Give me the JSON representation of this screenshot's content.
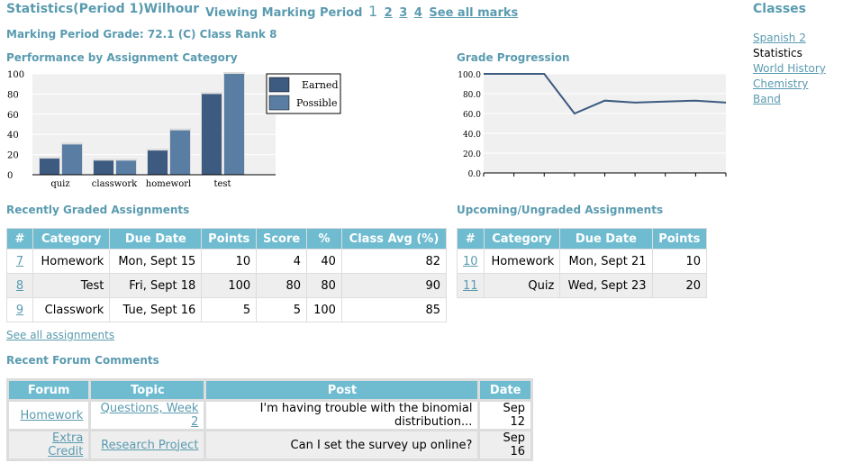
{
  "header": {
    "title": "Statistics(Period 1)Wilhour",
    "viewing_label": "Viewing Marking Period",
    "current_period": "1",
    "periods": [
      "2",
      "3",
      "4"
    ],
    "see_all_marks": "See all marks",
    "grade_line": "Marking Period Grade: 72.1 (C) Class Rank 8"
  },
  "classes": {
    "title": "Classes",
    "items": [
      {
        "label": "Spanish 2",
        "link": true
      },
      {
        "label": "Statistics",
        "link": false
      },
      {
        "label": "World History",
        "link": true
      },
      {
        "label": "Chemistry",
        "link": true
      },
      {
        "label": "Band",
        "link": true
      }
    ]
  },
  "performance": {
    "title": "Performance by Assignment Category",
    "chart_data": {
      "type": "bar",
      "categories": [
        "quiz",
        "classwork",
        "homeworl",
        "test"
      ],
      "series": [
        {
          "name": "Earned",
          "values": [
            16,
            14,
            24,
            80
          ],
          "color": "#3d5a80"
        },
        {
          "name": "Possible",
          "values": [
            30,
            14,
            44,
            100
          ],
          "color": "#5a7da3"
        }
      ],
      "yticks": [
        0,
        20,
        40,
        60,
        80,
        100
      ],
      "ylim": [
        0,
        100
      ],
      "legend": "top-right"
    }
  },
  "progression": {
    "title": "Grade Progression",
    "chart_data": {
      "type": "line",
      "values": [
        100,
        100,
        100,
        60,
        73,
        71,
        72,
        73,
        71
      ],
      "yticks": [
        "0.0",
        "20.0",
        "40.0",
        "60.0",
        "80.0",
        "100.0"
      ],
      "ylim": [
        0,
        100
      ],
      "color": "#3d5a80"
    }
  },
  "recent": {
    "title": "Recently Graded Assignments",
    "columns": [
      "#",
      "Category",
      "Due Date",
      "Points",
      "Score",
      "%",
      "Class Avg (%)"
    ],
    "rows": [
      {
        "num": "7",
        "category": "Homework",
        "due": "Mon, Sept 15",
        "points": "10",
        "score": "4",
        "pct": "40",
        "avg": "82"
      },
      {
        "num": "8",
        "category": "Test",
        "due": "Fri, Sept 18",
        "points": "100",
        "score": "80",
        "pct": "80",
        "avg": "90"
      },
      {
        "num": "9",
        "category": "Classwork",
        "due": "Tue, Sept 16",
        "points": "5",
        "score": "5",
        "pct": "100",
        "avg": "85"
      }
    ],
    "see_all": "See all assignments"
  },
  "upcoming": {
    "title": "Upcoming/Ungraded Assignments",
    "columns": [
      "#",
      "Category",
      "Due Date",
      "Points"
    ],
    "rows": [
      {
        "num": "10",
        "category": "Homework",
        "due": "Mon, Sept 21",
        "points": "10"
      },
      {
        "num": "11",
        "category": "Quiz",
        "due": "Wed, Sept 23",
        "points": "20"
      }
    ]
  },
  "forum": {
    "title": "Recent Forum Comments",
    "columns": [
      "Forum",
      "Topic",
      "Post",
      "Date"
    ],
    "rows": [
      {
        "forum": "Homework",
        "topic": "Questions, Week 2",
        "post": "I'm having trouble with the binomial distribution...",
        "date": "Sep 12"
      },
      {
        "forum": "Extra Credit",
        "topic": "Research Project",
        "post": "Can I set the survey up online?",
        "date": "Sep 16"
      }
    ]
  }
}
